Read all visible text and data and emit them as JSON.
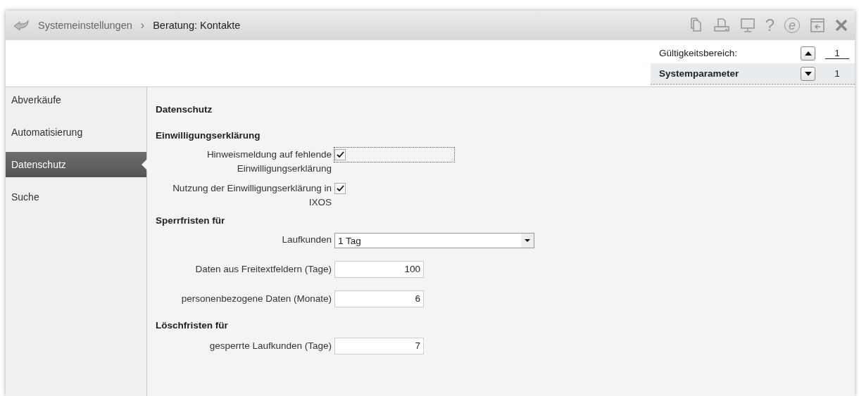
{
  "breadcrumb": {
    "items": [
      "Systemeinstellungen",
      "Beratung: Kontakte"
    ],
    "separator": "›"
  },
  "toolbar": [
    {
      "kind": "copy"
    },
    {
      "kind": "print"
    },
    {
      "kind": "monitor"
    },
    {
      "kind": "glyph",
      "glyph": "?"
    },
    {
      "kind": "circle-glyph",
      "glyph": "e"
    },
    {
      "kind": "exit"
    },
    {
      "kind": "close"
    }
  ],
  "scope": {
    "label": "Gültigkeitsbereich:",
    "value": "1",
    "row_label": "Systemparameter",
    "row_value": "1"
  },
  "sidebar": {
    "items": [
      {
        "label": "Abverkäufe",
        "selected": false
      },
      {
        "label": "Automatisierung",
        "selected": false
      },
      {
        "label": "Datenschutz",
        "selected": true
      },
      {
        "label": "Suche",
        "selected": false
      }
    ]
  },
  "form": {
    "title": "Datenschutz",
    "rows": [
      {
        "kind": "heading",
        "label": "Einwilligungserklärung"
      },
      {
        "kind": "checkbox",
        "label": "Hinweismeldung auf fehlende Einwilligungserklärung",
        "checked": true,
        "focused": true
      },
      {
        "kind": "checkbox",
        "label": "Nutzung der Einwilligungserklärung in IXOS",
        "checked": true,
        "focused": false
      },
      {
        "kind": "heading",
        "label": "Sperrfristen für"
      },
      {
        "kind": "select",
        "label": "Laufkunden",
        "value": "1 Tag"
      },
      {
        "kind": "number",
        "label": "Daten aus Freitextfeldern (Tage)",
        "value": "100"
      },
      {
        "kind": "number",
        "label": "personenbezogene Daten (Monate)",
        "value": "6"
      },
      {
        "kind": "heading",
        "label": "Löschfristen für"
      },
      {
        "kind": "number",
        "label": "gesperrte Laufkunden (Tage)",
        "value": "7"
      }
    ]
  }
}
